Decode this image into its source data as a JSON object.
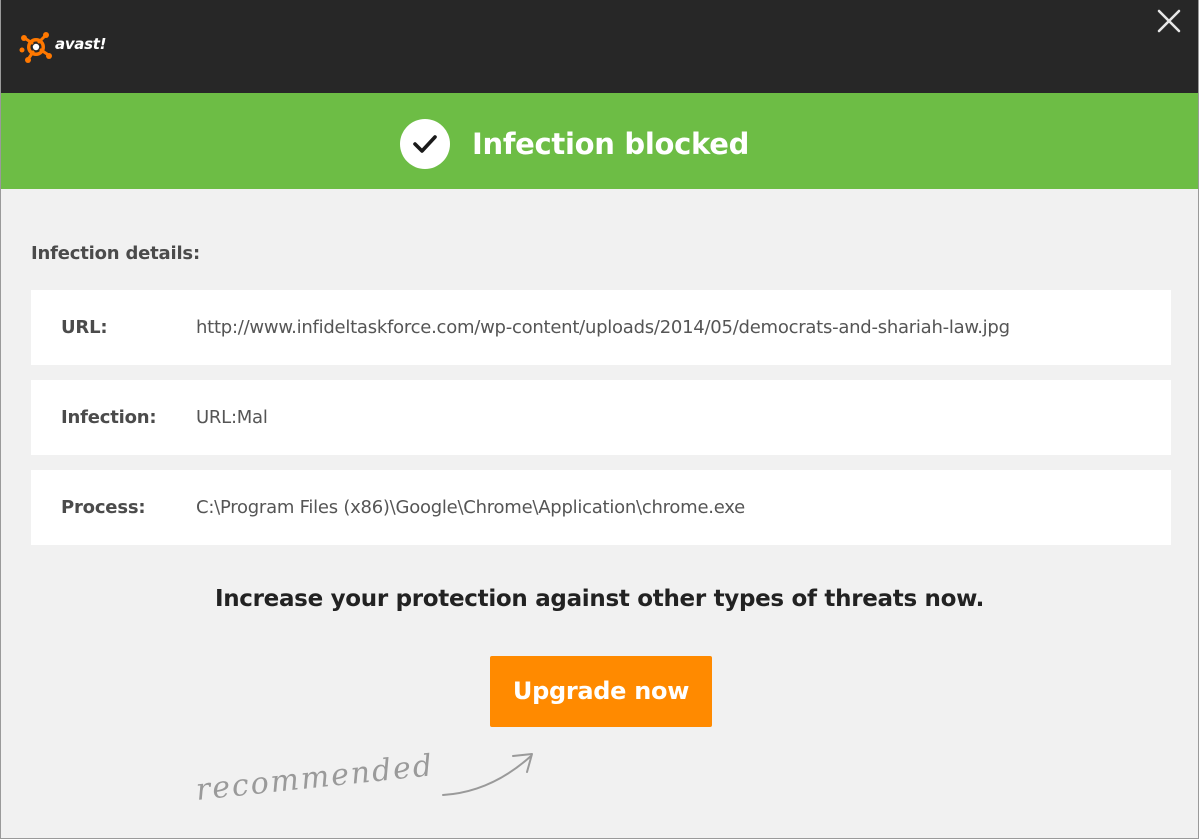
{
  "app": {
    "logo_text": "avast!",
    "close_icon": "close-icon"
  },
  "banner": {
    "title": "Infection blocked",
    "icon": "checkmark-icon",
    "color": "#6dbd45"
  },
  "details": {
    "heading": "Infection details:",
    "rows": [
      {
        "label": "URL:",
        "value": "http://www.infideltaskforce.com/wp-content/uploads/2014/05/democrats-and-shariah-law.jpg"
      },
      {
        "label": "Infection:",
        "value": "URL:Mal"
      },
      {
        "label": "Process:",
        "value": "C:\\Program Files (x86)\\Google\\Chrome\\Application\\chrome.exe"
      }
    ]
  },
  "promo": {
    "text": "Increase your protection against other types of threats now.",
    "button_label": "Upgrade now",
    "button_color": "#ff8a00",
    "recommended_text": "recommended"
  }
}
